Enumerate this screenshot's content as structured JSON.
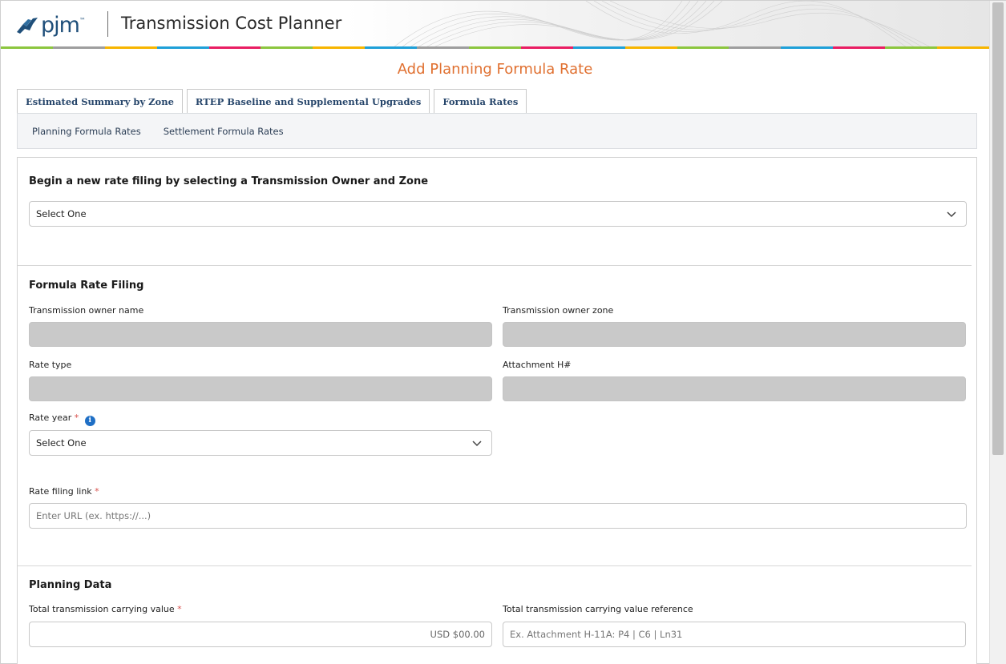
{
  "header": {
    "logo_text": "pjm",
    "logo_tm": "™",
    "app_title": "Transmission Cost Planner",
    "stripe_colors": [
      "#8cc63f",
      "#9e9e9e",
      "#f7b500",
      "#1fa0d8",
      "#e91e63",
      "#8cc63f",
      "#f7b500",
      "#1fa0d8",
      "#9e9e9e",
      "#8cc63f",
      "#e91e63",
      "#1fa0d8",
      "#f7b500",
      "#8cc63f",
      "#9e9e9e",
      "#1fa0d8",
      "#e91e63",
      "#8cc63f",
      "#f7b500"
    ]
  },
  "page": {
    "title": "Add Planning Formula Rate"
  },
  "tabs": [
    {
      "label": "Estimated Summary by Zone"
    },
    {
      "label": "RTEP Baseline and Supplemental Upgrades"
    },
    {
      "label": "Formula Rates"
    }
  ],
  "subnav": [
    {
      "label": "Planning Formula Rates"
    },
    {
      "label": "Settlement Formula Rates"
    }
  ],
  "begin": {
    "title": "Begin a new rate filing by selecting a Transmission Owner and Zone",
    "select_value": "Select One"
  },
  "filing": {
    "title": "Formula Rate Filing",
    "owner_name_label": "Transmission owner name",
    "owner_zone_label": "Transmission owner zone",
    "rate_type_label": "Rate type",
    "attachment_label": "Attachment H#",
    "rate_year_label": "Rate year",
    "rate_year_value": "Select One",
    "rate_filing_link_label": "Rate filing link",
    "rate_filing_link_placeholder": "Enter URL (ex. https://...)",
    "required_mark": "*",
    "info_glyph": "i"
  },
  "planning": {
    "title": "Planning Data",
    "carrying_value_label": "Total transmission carrying value",
    "carrying_value_value": "USD $00.00",
    "carrying_value_ref_label": "Total transmission carrying value reference",
    "carrying_value_ref_placeholder": "Ex. Attachment H-11A: P4 | C6 | Ln31"
  },
  "colors": {
    "accent_orange": "#e07030",
    "nav_blue": "#27466b",
    "disabled_gray": "#c9c9c9",
    "required_red": "#d9534f",
    "info_blue": "#1f6fc5"
  }
}
